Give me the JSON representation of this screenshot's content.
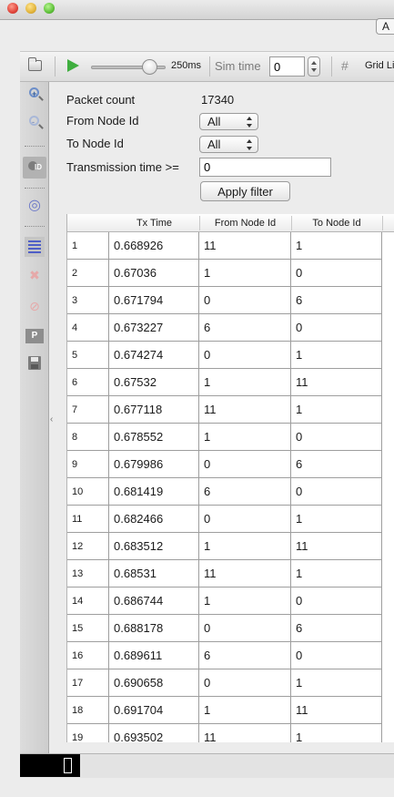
{
  "window": {
    "partial_button_label": "A"
  },
  "toolbar": {
    "speed_label": "250ms",
    "sim_time_label": "Sim time",
    "sim_time_value": "0",
    "grid_label": "Grid Li"
  },
  "filter": {
    "packet_count_label": "Packet count",
    "packet_count_value": "17340",
    "from_node_label": "From Node Id",
    "from_node_selected": "All",
    "to_node_label": "To Node Id",
    "to_node_selected": "All",
    "tx_time_label": "Transmission time >=",
    "tx_time_value": "0",
    "apply_label": "Apply filter"
  },
  "table": {
    "columns": [
      "Tx Time",
      "From Node Id",
      "To Node Id"
    ],
    "rows": [
      {
        "idx": "1",
        "tx": "0.668926",
        "from": "11",
        "to": "1"
      },
      {
        "idx": "2",
        "tx": "0.67036",
        "from": "1",
        "to": "0"
      },
      {
        "idx": "3",
        "tx": "0.671794",
        "from": "0",
        "to": "6"
      },
      {
        "idx": "4",
        "tx": "0.673227",
        "from": "6",
        "to": "0"
      },
      {
        "idx": "5",
        "tx": "0.674274",
        "from": "0",
        "to": "1"
      },
      {
        "idx": "6",
        "tx": "0.67532",
        "from": "1",
        "to": "11"
      },
      {
        "idx": "7",
        "tx": "0.677118",
        "from": "11",
        "to": "1"
      },
      {
        "idx": "8",
        "tx": "0.678552",
        "from": "1",
        "to": "0"
      },
      {
        "idx": "9",
        "tx": "0.679986",
        "from": "0",
        "to": "6"
      },
      {
        "idx": "10",
        "tx": "0.681419",
        "from": "6",
        "to": "0"
      },
      {
        "idx": "11",
        "tx": "0.682466",
        "from": "0",
        "to": "1"
      },
      {
        "idx": "12",
        "tx": "0.683512",
        "from": "1",
        "to": "11"
      },
      {
        "idx": "13",
        "tx": "0.68531",
        "from": "11",
        "to": "1"
      },
      {
        "idx": "14",
        "tx": "0.686744",
        "from": "1",
        "to": "0"
      },
      {
        "idx": "15",
        "tx": "0.688178",
        "from": "0",
        "to": "6"
      },
      {
        "idx": "16",
        "tx": "0.689611",
        "from": "6",
        "to": "0"
      },
      {
        "idx": "17",
        "tx": "0.690658",
        "from": "0",
        "to": "1"
      },
      {
        "idx": "18",
        "tx": "0.691704",
        "from": "1",
        "to": "11"
      },
      {
        "idx": "19",
        "tx": "0.693502",
        "from": "11",
        "to": "1"
      }
    ]
  },
  "icons": {
    "toolbar": [
      "folder-icon",
      "play-icon",
      "grid-icon"
    ],
    "sidebar": [
      "zoom-in-icon",
      "zoom-out-icon",
      "node-id-icon",
      "spiral-icon",
      "packet-list-icon",
      "no-network-icon",
      "no-entry-icon",
      "p-icon",
      "save-icon"
    ]
  },
  "colors": {
    "play": "#3fae3f",
    "list_icon": "#4f5fc7",
    "zoom_icon": "#2c5aa0"
  }
}
